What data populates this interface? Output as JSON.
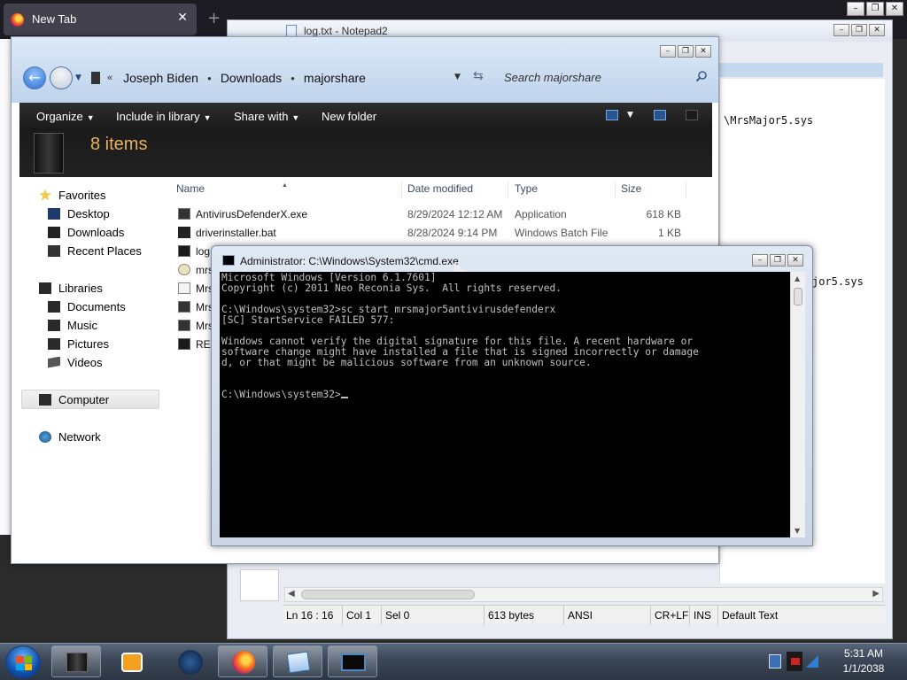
{
  "firefox": {
    "tab_title": "New Tab",
    "close_glyph": "✕",
    "new_tab_glyph": "+"
  },
  "notepad": {
    "title": "log.txt - Notepad2",
    "editor_lines": [
      "\\MrsMajor5.sys",
      "jor5.sys"
    ],
    "status": {
      "position": "Ln 16 : 16",
      "col": "Col 1",
      "sel": "Sel 0",
      "size": "613 bytes",
      "encoding": "ANSI",
      "eol": "CR+LF",
      "mode": "INS",
      "scheme": "Default Text"
    }
  },
  "explorer": {
    "breadcrumbs": [
      "Joseph Biden",
      "Downloads",
      "majorshare"
    ],
    "search_placeholder": "Search majorshare",
    "toolbar": {
      "organize": "Organize",
      "include_in_library": "Include in library",
      "share_with": "Share with",
      "new_folder": "New folder"
    },
    "item_count": "8 items",
    "nav": {
      "favorites": "Favorites",
      "desktop": "Desktop",
      "downloads": "Downloads",
      "recent_places": "Recent Places",
      "libraries": "Libraries",
      "documents": "Documents",
      "music": "Music",
      "pictures": "Pictures",
      "videos": "Videos",
      "computer": "Computer",
      "network": "Network"
    },
    "columns": {
      "name": "Name",
      "date": "Date modified",
      "type": "Type",
      "size": "Size"
    },
    "files": [
      {
        "name": "AntivirusDefenderX.exe",
        "date": "8/29/2024 12:12 AM",
        "type": "Application",
        "size": "618 KB",
        "icon": "exe-icon"
      },
      {
        "name": "driverinstaller.bat",
        "date": "8/28/2024 9:14 PM",
        "type": "Windows Batch File",
        "size": "1 KB",
        "icon": "bat-icon"
      },
      {
        "name": "log",
        "date": "",
        "type": "",
        "size": "",
        "icon": "txt-icon"
      },
      {
        "name": "mrs",
        "date": "",
        "type": "",
        "size": "",
        "icon": "settings-file-icon"
      },
      {
        "name": "Mrs",
        "date": "",
        "type": "",
        "size": "",
        "icon": "sys-icon"
      },
      {
        "name": "Mrs",
        "date": "",
        "type": "",
        "size": "",
        "icon": "exe-icon"
      },
      {
        "name": "Mrs",
        "date": "",
        "type": "",
        "size": "",
        "icon": "exe-icon"
      },
      {
        "name": "REA",
        "date": "",
        "type": "",
        "size": "",
        "icon": "txt-icon"
      }
    ]
  },
  "cmd": {
    "title": "Administrator: C:\\Windows\\System32\\cmd.exe",
    "lines": [
      "Microsoft Windows [Version 6.1.7601]",
      "Copyright (c) 2011 Neo Reconia Sys.  All rights reserved.",
      "",
      "C:\\Windows\\system32>sc start mrsmajor5antivirusdefenderx",
      "[SC] StartService FAILED 577:",
      "",
      "Windows cannot verify the digital signature for this file. A recent hardware or",
      "software change might have installed a file that is signed incorrectly or damage",
      "d, or that might be malicious software from an unknown source.",
      "",
      "",
      "C:\\Windows\\system32>"
    ]
  },
  "taskbar": {
    "time": "5:31 AM",
    "date": "1/1/2038",
    "apps": [
      "explorer-icon",
      "media-player-icon",
      "globe-icon",
      "firefox-icon",
      "notepad-icon",
      "cmd-icon"
    ]
  },
  "colors": {
    "console_text": "#c0c0c0",
    "item_count_accent": "#e9b160"
  }
}
